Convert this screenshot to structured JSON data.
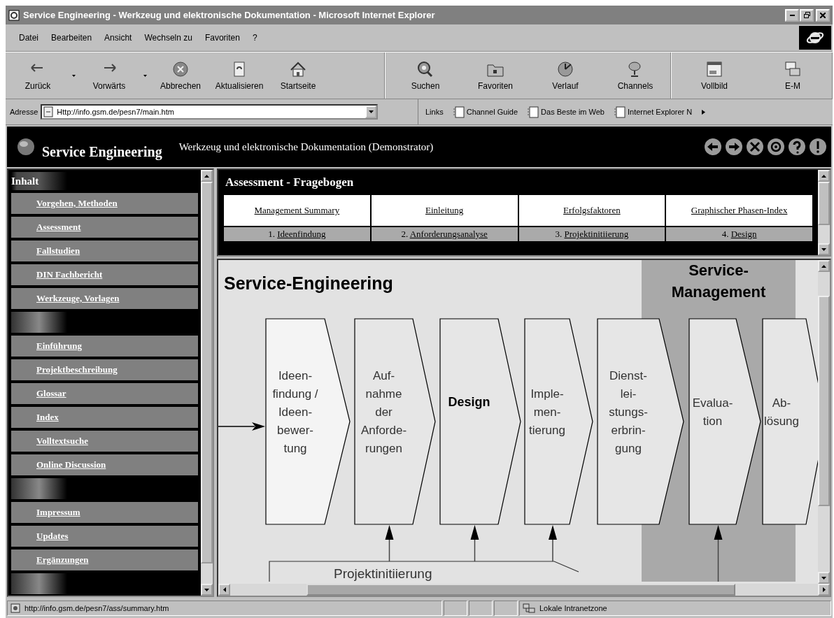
{
  "window": {
    "title": "Service Engineering - Werkzeug und elektronische Dokumentation - Microsoft Internet Explorer"
  },
  "menu": [
    "Datei",
    "Bearbeiten",
    "Ansicht",
    "Wechseln zu",
    "Favoriten",
    "?"
  ],
  "toolbar": [
    [
      {
        "label": "Zurück",
        "dropdown": true
      },
      {
        "label": "Vorwärts",
        "dropdown": true
      },
      {
        "label": "Abbrechen",
        "dropdown": false
      },
      {
        "label": "Aktualisieren",
        "dropdown": false
      },
      {
        "label": "Startseite",
        "dropdown": false
      }
    ],
    [
      {
        "label": "Suchen",
        "dropdown": false
      },
      {
        "label": "Favoriten",
        "dropdown": false
      },
      {
        "label": "Verlauf",
        "dropdown": false
      },
      {
        "label": "Channels",
        "dropdown": false
      }
    ],
    [
      {
        "label": "Vollbild",
        "dropdown": false
      },
      {
        "label": "E-M",
        "dropdown": false
      }
    ]
  ],
  "address": {
    "label": "Adresse",
    "value": "Http://info.gsm.de/pesn7/main.htm"
  },
  "links": {
    "label": "Links",
    "items": [
      "Channel Guide",
      "Das Beste im Web",
      "Internet Explorer N"
    ]
  },
  "site_header": {
    "title": "Service Engineering",
    "subtitle": "Werkzeug und elektronische Dokumentation (Demonstrator)"
  },
  "sidebar": {
    "heading": "Inhalt",
    "groups": [
      [
        "Vorgehen, Methoden",
        "Assessment",
        "Fallstudien",
        "DIN Fachbericht",
        "Werkzeuge, Vorlagen"
      ],
      [
        "Einführung",
        "Projektbeschreibung",
        "Glossar",
        "Index",
        "Volltextsuche",
        "Online Discussion"
      ],
      [
        "Impressum",
        "Updates",
        "Ergänzungen"
      ]
    ]
  },
  "assessment": {
    "title": "Assessment - Fragebogen",
    "links": [
      "Management Summary",
      "Einleitung",
      "Erfolgsfaktoren",
      "Graphischer Phasen-Index"
    ],
    "phases": [
      {
        "number": "1.",
        "link": "Ideenfindung"
      },
      {
        "number": "2.",
        "link": "Anforderungsanalyse"
      },
      {
        "number": "3.",
        "link": "Projektinitiierung"
      },
      {
        "number": "4.",
        "link": "Design"
      }
    ]
  },
  "diagram": {
    "title": "Service-Engineering",
    "band_title": "Service-Management",
    "bottom_arrow": "Projektinitiierung",
    "steps": [
      {
        "kind": "start",
        "lines": [
          "Ideen-",
          "findung /",
          "Ideen-",
          "bewer-",
          "tung"
        ],
        "emphasis": false,
        "arrow_below": false
      },
      {
        "kind": "step",
        "lines": [
          "Auf-",
          "nahme",
          "der",
          "Anforde-",
          "rungen"
        ],
        "emphasis": false,
        "arrow_below": true
      },
      {
        "kind": "step",
        "lines": [
          "Design"
        ],
        "emphasis": true,
        "arrow_below": true
      },
      {
        "kind": "step",
        "lines": [
          "Imple-",
          "men-",
          "tierung"
        ],
        "emphasis": false,
        "arrow_below": true
      },
      {
        "kind": "step",
        "lines": [
          "Dienst-",
          "lei-",
          "stungs-",
          "erbrin-",
          "gung"
        ],
        "emphasis": false,
        "arrow_below": false
      },
      {
        "kind": "step",
        "lines": [
          "Evalua-",
          "tion"
        ],
        "emphasis": false,
        "arrow_below": true
      },
      {
        "kind": "step",
        "lines": [
          "Ab-",
          "lösung"
        ],
        "emphasis": false,
        "arrow_below": false
      }
    ]
  },
  "status_bar": {
    "url": "http://info.gsm.de/pesn7/ass/summary.htm",
    "zone": "Lokale Intranetzone"
  }
}
